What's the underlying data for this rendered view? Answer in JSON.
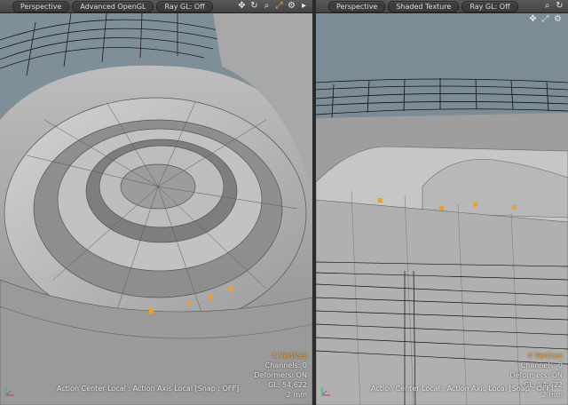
{
  "left_viewport": {
    "tabs": [
      "Perspective",
      "Advanced OpenGL",
      "Ray GL: Off"
    ],
    "icons": [
      "move-view-icon",
      "rotate-view-icon",
      "zoom-view-icon",
      "maximize-icon",
      "settings-gear-icon",
      "expand-arrow-icon"
    ],
    "hud": {
      "selection": "4 Vertices",
      "channels": "Channels: 0",
      "deformers": "Deformers: ON",
      "gl": "GL: 54,622",
      "scale": "2 mm"
    },
    "status": "Action Center Local : Action Axis Local  [Snap : OFF]"
  },
  "right_viewport": {
    "tabs": [
      "Perspective",
      "Shaded Texture",
      "Ray GL: Off"
    ],
    "icons": [
      "zoom-view-icon",
      "rotate-view-icon",
      "move-view-icon",
      "maximize-icon",
      "settings-gear-icon"
    ],
    "hud": {
      "selection": "4 Vertices",
      "channels": "Channels: 0",
      "deformers": "Deformers: ON",
      "gl": "GL: 54,622",
      "scale": "2 mm"
    },
    "status": "Action Center Local : Action Axis Local  [Snap : OFF]"
  },
  "colors": {
    "accent_vertex": "#f0a020",
    "hud_accent": "#f0b030",
    "background": "#6c7e8a"
  }
}
